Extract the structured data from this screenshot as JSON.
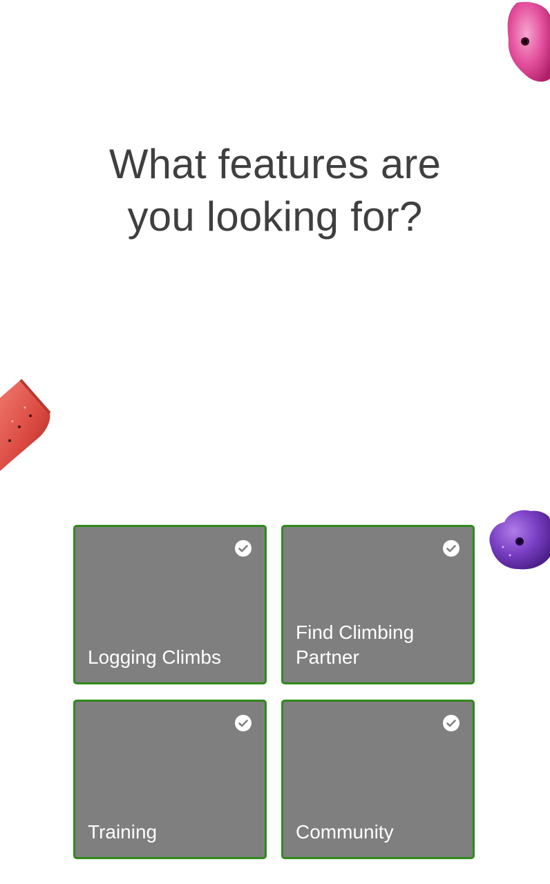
{
  "heading": {
    "line1": "What features are",
    "line2": "you looking for?"
  },
  "features": [
    {
      "label": "Logging Climbs",
      "selected": true,
      "icon": "check-circle-icon"
    },
    {
      "label": "Find Climbing Partner",
      "selected": true,
      "icon": "check-circle-icon"
    },
    {
      "label": "Training",
      "selected": true,
      "icon": "check-circle-icon"
    },
    {
      "label": "Community",
      "selected": true,
      "icon": "check-circle-icon"
    }
  ],
  "colors": {
    "card_fill": "#7f7f7f",
    "card_border_selected": "#2f8a1a",
    "heading_text": "#3f3f3f",
    "hold_pink": "#e34f9c",
    "hold_red": "#d9473f",
    "hold_purple": "#7a3fc4"
  }
}
